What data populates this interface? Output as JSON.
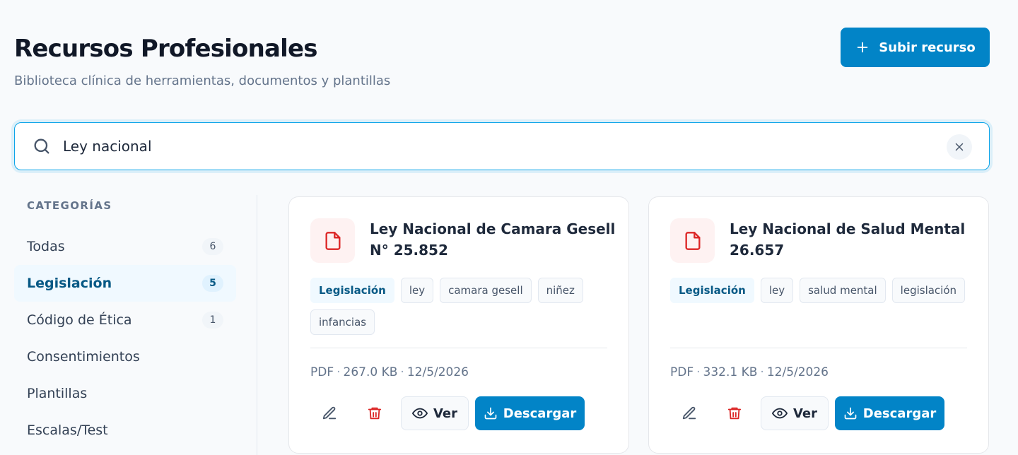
{
  "header": {
    "title": "Recursos Profesionales",
    "subtitle": "Biblioteca clínica de herramientas, documentos y plantillas",
    "upload_label": "Subir recurso"
  },
  "search": {
    "value": "Ley nacional"
  },
  "sidebar": {
    "heading": "CATEGORÍAS",
    "items": [
      {
        "label": "Todas",
        "count": "6"
      },
      {
        "label": "Legislación",
        "count": "5",
        "active": true
      },
      {
        "label": "Código de Ética",
        "count": "1"
      },
      {
        "label": "Consentimientos"
      },
      {
        "label": "Plantillas"
      },
      {
        "label": "Escalas/Test"
      }
    ]
  },
  "cards": [
    {
      "title": "Ley Nacional de Camara Gesell N° 25.852",
      "category": "Legislación",
      "tags": [
        "ley",
        "camara gesell",
        "niñez",
        "infancias"
      ],
      "format": "PDF",
      "size": "267.0 KB",
      "date": "12/5/2026",
      "view_label": "Ver",
      "download_label": "Descargar"
    },
    {
      "title": "Ley Nacional de Salud Mental 26.657",
      "category": "Legislación",
      "tags": [
        "ley",
        "salud mental",
        "legislación"
      ],
      "format": "PDF",
      "size": "332.1 KB",
      "date": "12/5/2026",
      "view_label": "Ver",
      "download_label": "Descargar"
    }
  ],
  "meta_separator": "·",
  "colors": {
    "accent": "#0284c7",
    "danger": "#dc2626",
    "active_bg": "#f0f9ff"
  },
  "icons": {
    "upload": "plus-icon",
    "search": "search-icon",
    "clear": "close-icon",
    "document": "document-icon",
    "edit": "edit-icon",
    "delete": "trash-icon",
    "view": "eye-icon",
    "download": "download-icon"
  }
}
